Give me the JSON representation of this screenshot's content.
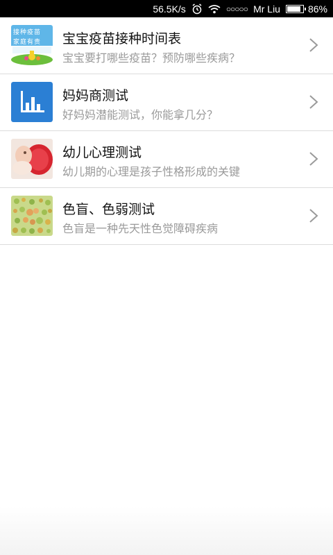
{
  "status_bar": {
    "network_speed": "56.5K/s",
    "carrier": "Mr Liu",
    "battery_text": "86%",
    "battery_level": 0.86,
    "icons": [
      "alarm-icon",
      "wifi-icon",
      "signal-dots-icon",
      "battery-icon"
    ]
  },
  "list": {
    "items": [
      {
        "title": "宝宝疫苗接种时间表",
        "subtitle": "宝宝要打哪些疫苗？预防哪些疾病？",
        "thumb_text_line1": "接种疫苗",
        "thumb_text_line2": "家庭有责",
        "icon": "vaccine-thumbnail"
      },
      {
        "title": "妈妈商测试",
        "subtitle": "好妈妈潜能测试，你能拿几分？",
        "icon": "bar-chart-icon"
      },
      {
        "title": "幼儿心理测试",
        "subtitle": "幼儿期的心理是孩子性格形成的关键",
        "icon": "baby-photo-thumbnail"
      },
      {
        "title": "色盲、色弱测试",
        "subtitle": "色盲是一种先天性色觉障碍疾病",
        "icon": "color-blind-plate-thumbnail"
      }
    ]
  },
  "colors": {
    "status_bar_bg": "#000000",
    "title_text": "#111111",
    "subtitle_text": "#9a9a9a",
    "divider": "#dcdcdc",
    "chart_icon_bg": "#2b7fd4",
    "chevron": "#9a9a9a"
  }
}
